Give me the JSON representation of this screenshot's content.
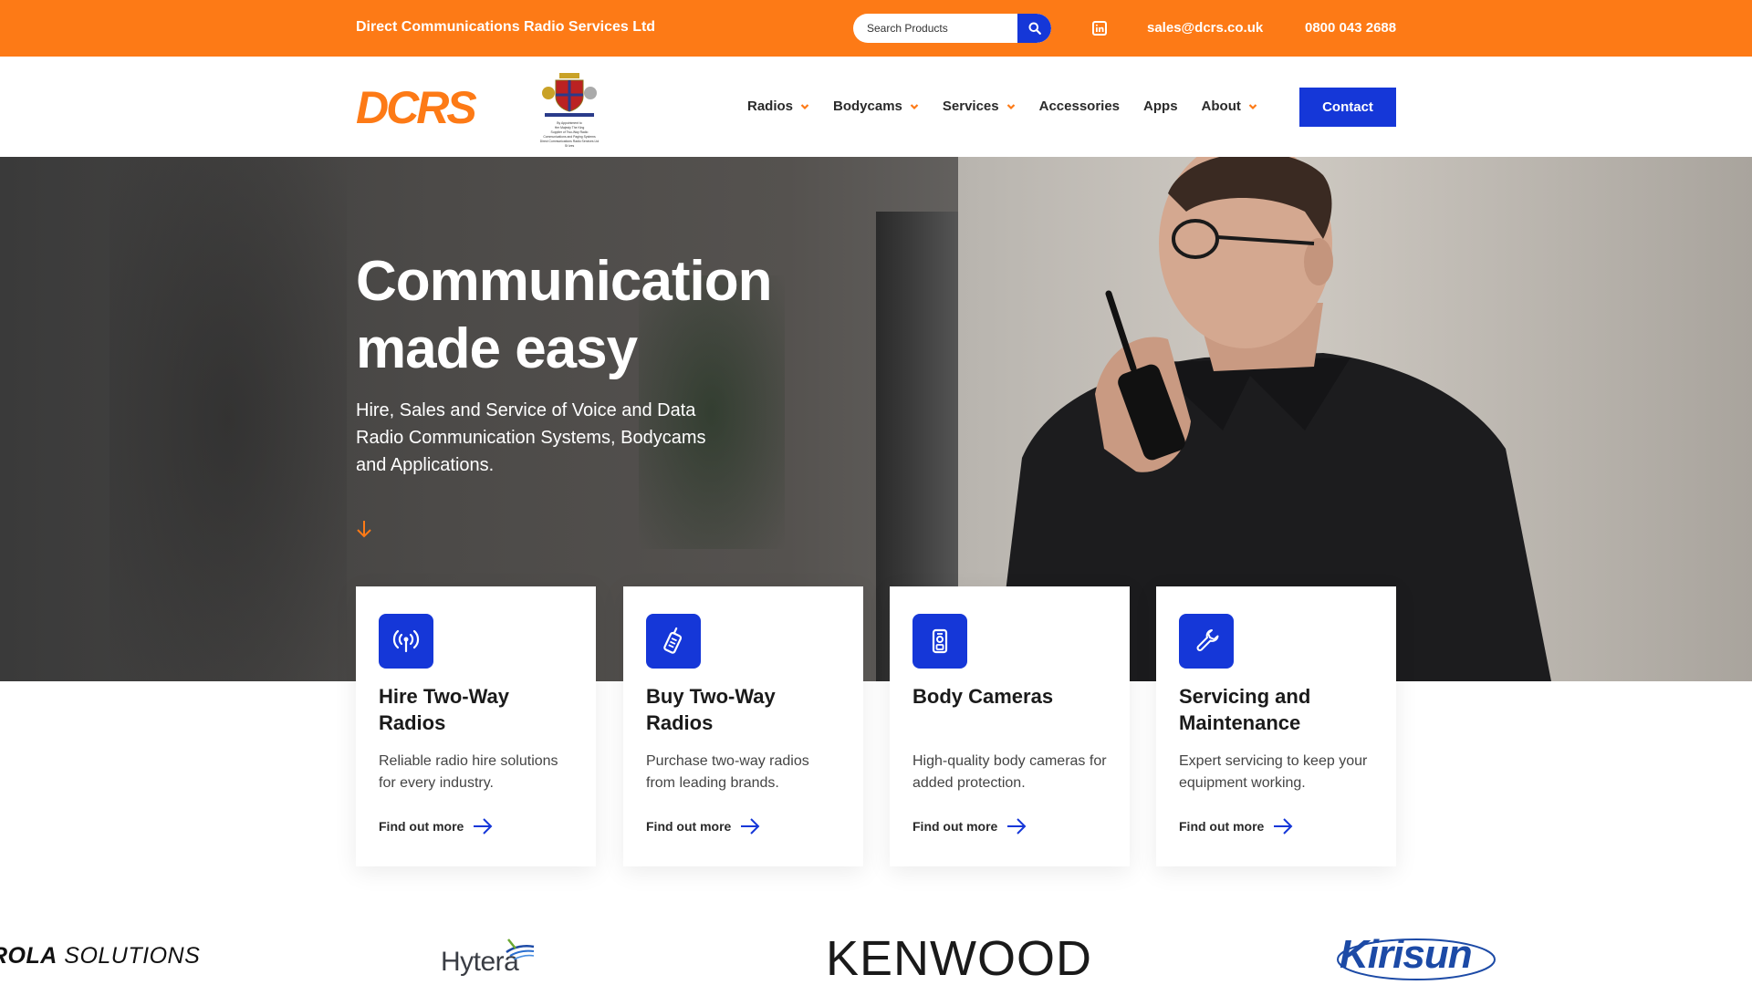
{
  "topbar": {
    "company": "Direct Communications Radio Services Ltd",
    "search_placeholder": "Search Products",
    "email": "sales@dcrs.co.uk",
    "phone": "0800 043 2688",
    "icons": {
      "search": "search-icon",
      "social": "linkedin-icon"
    },
    "bg_color": "#fd7a16"
  },
  "header": {
    "logo_text": "DCRS",
    "crest_text": "By Appointment to Her Majesty The King Supplier of Two-Way Radio Communications and Paging Systems Direct Communications Radio Services Ltd St Ives",
    "nav": [
      {
        "label": "Radios",
        "dropdown": true
      },
      {
        "label": "Bodycams",
        "dropdown": true
      },
      {
        "label": "Services",
        "dropdown": true
      },
      {
        "label": "Accessories",
        "dropdown": false
      },
      {
        "label": "Apps",
        "dropdown": false
      },
      {
        "label": "About",
        "dropdown": true
      }
    ],
    "contact_label": "Contact",
    "accent_color": "#1537d8"
  },
  "hero": {
    "title": "Communication made easy",
    "subtitle": "Hire, Sales and Service of Voice and Data Radio Communication Systems, Bodycams and Applications."
  },
  "cards": [
    {
      "title": "Hire Two-Way Radios",
      "text": "Reliable radio hire solutions for every industry.",
      "link": "Find out more",
      "icon": "antenna-icon"
    },
    {
      "title": "Buy Two-Way Radios",
      "text": "Purchase two-way radios from leading brands.",
      "link": "Find out more",
      "icon": "radio-icon"
    },
    {
      "title": "Body Cameras",
      "text": "High-quality body cameras for added protection.",
      "link": "Find out more",
      "icon": "bodycam-icon"
    },
    {
      "title": "Servicing and Maintenance",
      "text": "Expert servicing to keep your equipment working.",
      "link": "Find out more",
      "icon": "wrench-icon"
    }
  ],
  "brands": {
    "motorola_bold": "ROLA",
    "motorola_rest": " SOLUTIONS",
    "hytera": "Hytera",
    "kenwood": "KENWOOD",
    "kirisun": "Kirisun"
  }
}
